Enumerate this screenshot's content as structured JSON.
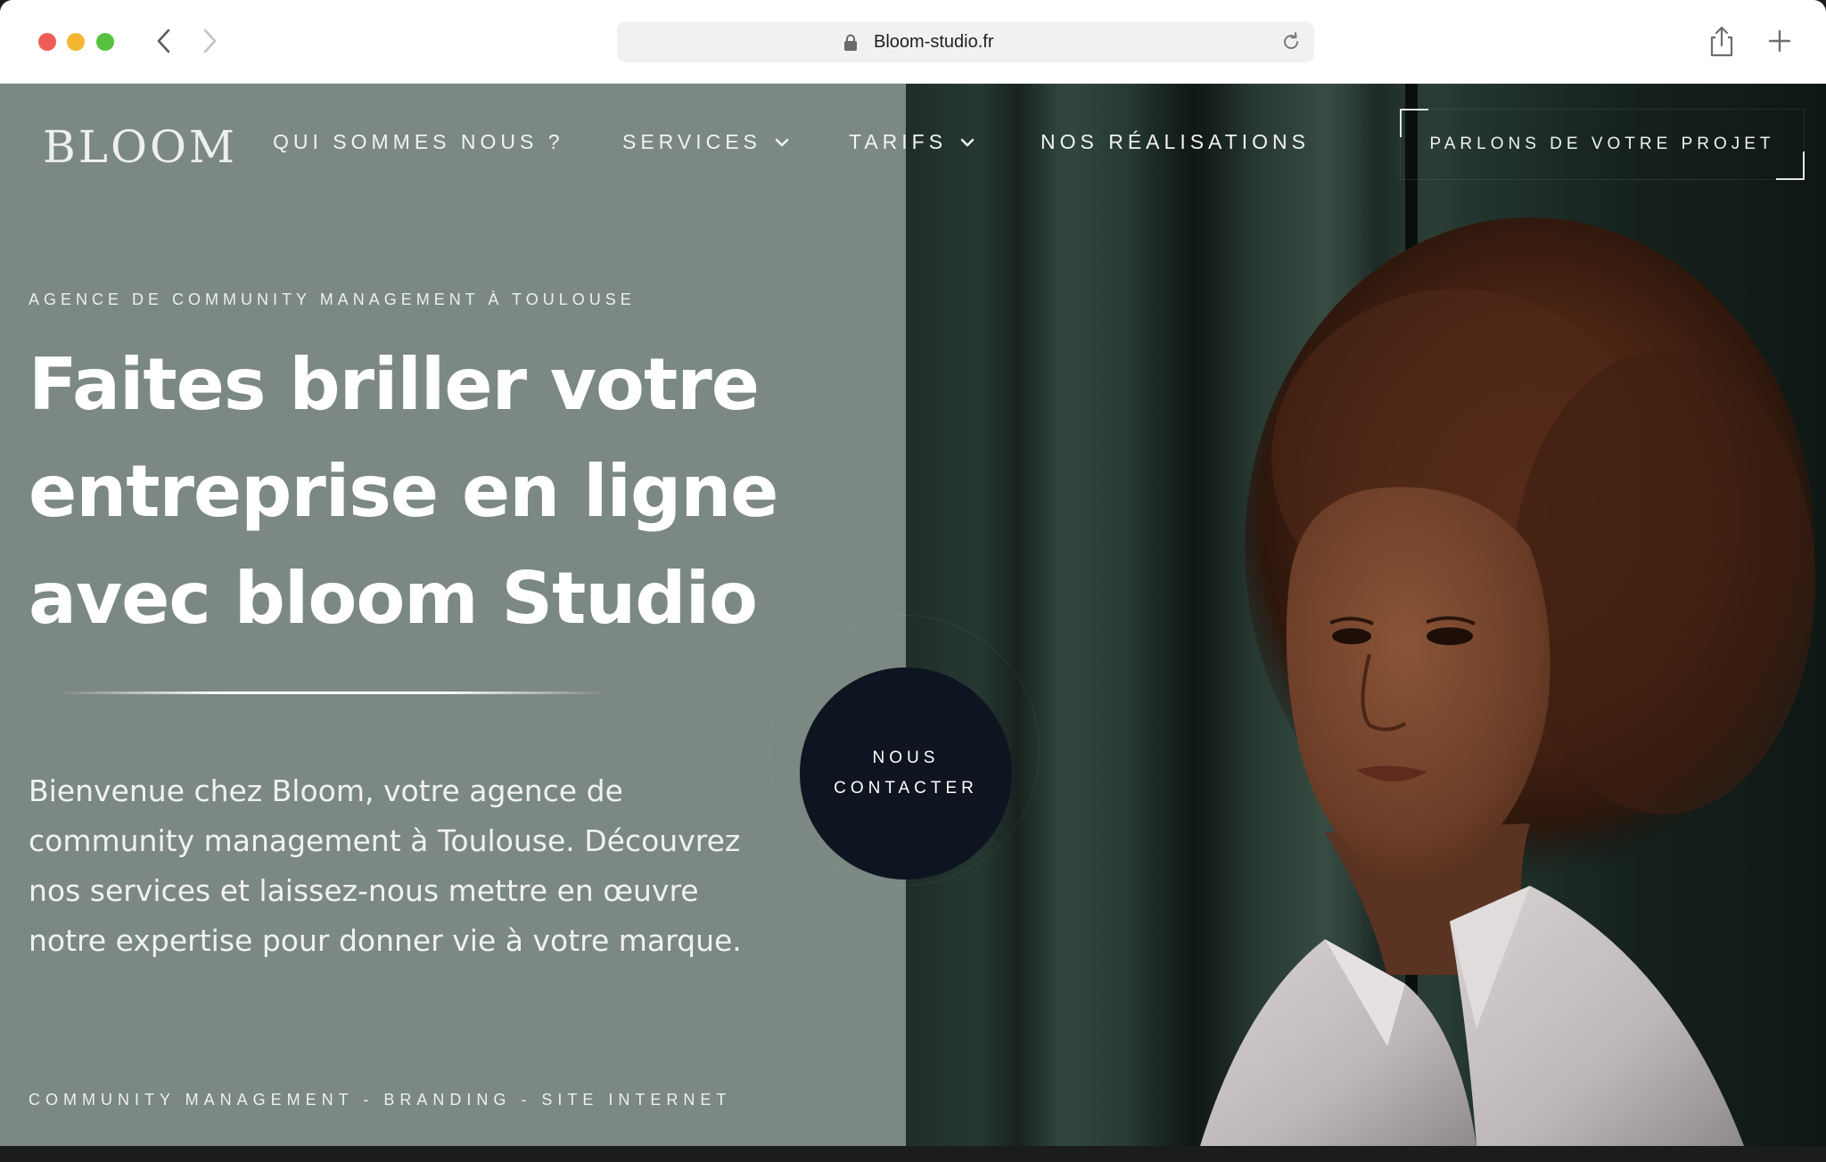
{
  "browser": {
    "url": "Bloom-studio.fr"
  },
  "header": {
    "logo": "BLOOM",
    "nav": [
      {
        "label": "QUI SOMMES NOUS ?",
        "dropdown": false
      },
      {
        "label": "SERVICES",
        "dropdown": true
      },
      {
        "label": "TARIFS",
        "dropdown": true
      },
      {
        "label": "NOS RÉALISATIONS",
        "dropdown": false
      }
    ],
    "cta_label": "PARLONS DE VOTRE PROJET"
  },
  "hero": {
    "eyebrow": "AGENCE DE COMMUNITY MANAGEMENT À TOULOUSE",
    "headline": "Faites briller votre entreprise en ligne avec bloom Studio",
    "intro": "Bienvenue chez Bloom, votre agence de community management à Toulouse. Découvrez nos services et laissez-nous mettre en œuvre notre expertise pour donner vie à votre marque.",
    "services_line": "COMMUNITY MANAGEMENT - BRANDING - SITE INTERNET",
    "contact_line1": "NOUS",
    "contact_line2": "CONTACTER"
  },
  "colors": {
    "hero_bg": "#7c8882",
    "contact_bg": "#0e1520",
    "text": "#ffffff"
  },
  "icons": [
    "back-arrow-icon",
    "forward-arrow-icon",
    "lock-icon",
    "reload-icon",
    "share-icon",
    "new-tab-plus-icon",
    "chevron-down-icon"
  ]
}
